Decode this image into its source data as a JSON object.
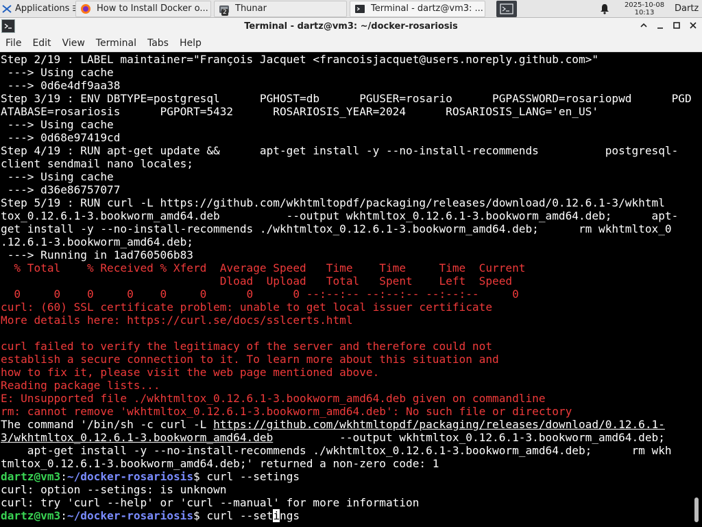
{
  "panel": {
    "apps_label": "Applications",
    "tasks": [
      {
        "label": "How to Install Docker o..."
      },
      {
        "label": "Thunar",
        "badge": "2"
      },
      {
        "label": "Terminal - dartz@vm3: ..."
      }
    ],
    "clock_date": "2025-10-08",
    "clock_time": "10:13",
    "user": "Dartz"
  },
  "window": {
    "title": "Terminal - dartz@vm3: ~/docker-rosariosis"
  },
  "menu": [
    "File",
    "Edit",
    "View",
    "Terminal",
    "Tabs",
    "Help"
  ],
  "terminal": {
    "lines": [
      "Step 2/19 : LABEL maintainer=\"François Jacquet <francoisjacquet@users.noreply.github.com>\"",
      " ---> Using cache",
      " ---> 0d6e4df9aa38",
      "Step 3/19 : ENV DBTYPE=postgresql      PGHOST=db      PGUSER=rosario      PGPASSWORD=rosariopwd      PGD",
      "ATABASE=rosariosis      PGPORT=5432      ROSARIOSIS_YEAR=2024      ROSARIOSIS_LANG='en_US'",
      " ---> Using cache",
      " ---> 0d68e97419cd",
      "Step 4/19 : RUN apt-get update &&      apt-get install -y --no-install-recommends          postgresql-",
      "client sendmail nano locales;",
      " ---> Using cache",
      " ---> d36e86757077",
      "Step 5/19 : RUN curl -L https://github.com/wkhtmltopdf/packaging/releases/download/0.12.6.1-3/wkhtml",
      "tox_0.12.6.1-3.bookworm_amd64.deb          --output wkhtmltox_0.12.6.1-3.bookworm_amd64.deb;      apt-",
      "get install -y --no-install-recommends ./wkhtmltox_0.12.6.1-3.bookworm_amd64.deb;      rm wkhtmltox_0",
      ".12.6.1-3.bookworm_amd64.deb;",
      " ---> Running in 1ad760506b83",
      "  % Total    % Received % Xferd  Average Speed   Time    Time     Time  Current",
      "                                 Dload  Upload   Total   Spent    Left  Speed",
      "  0     0    0     0    0     0      0      0 --:--:-- --:--:-- --:--:--     0",
      "curl: (60) SSL certificate problem: unable to get local issuer certificate",
      "More details here: https://curl.se/docs/sslcerts.html",
      "",
      "curl failed to verify the legitimacy of the server and therefore could not",
      "establish a secure connection to it. To learn more about this situation and",
      "how to fix it, please visit the web page mentioned above.",
      "Reading package lists...",
      "E: Unsupported file ./wkhtmltox_0.12.6.1-3.bookworm_amd64.deb given on commandline",
      "rm: cannot remove 'wkhtmltox_0.12.6.1-3.bookworm_amd64.deb': No such file or directory",
      "The command '/bin/sh -c curl -L https://github.com/wkhtmltopdf/packaging/releases/download/0.12.6.1-",
      "3/wkhtmltox_0.12.6.1-3.bookworm_amd64.deb          --output wkhtmltox_0.12.6.1-3.bookworm_amd64.deb;",
      "    apt-get install -y --no-install-recommends ./wkhtmltox_0.12.6.1-3.bookworm_amd64.deb;      rm wkh",
      "tmltox_0.12.6.1-3.bookworm_amd64.deb;' returned a non-zero code: 1"
    ],
    "red_from": 16,
    "red_to": 27,
    "prompt_user": "dartz@vm3",
    "prompt_path": "~/docker-rosariosis",
    "cmd1": "curl --setings",
    "out1": "curl: option --setings: is unknown",
    "out2": "curl: try 'curl --help' or 'curl --manual' for more information",
    "cmd2_before_cursor": "curl --set",
    "cmd2_cursor_char": "i",
    "cmd2_after_cursor": "ngs",
    "url_underlined": "https://github.com/wkhtmltopdf/packaging/releases/download/0.12.6.1-",
    "url_underlined_2": "3/wkhtmltox_0.12.6.1-3.bookworm_amd64.deb"
  },
  "colors": {
    "error_text": "#ef3a3a",
    "prompt_user": "#39d353",
    "prompt_path": "#7a8cff",
    "terminal_bg": "#000000",
    "terminal_fg": "#ffffff"
  }
}
